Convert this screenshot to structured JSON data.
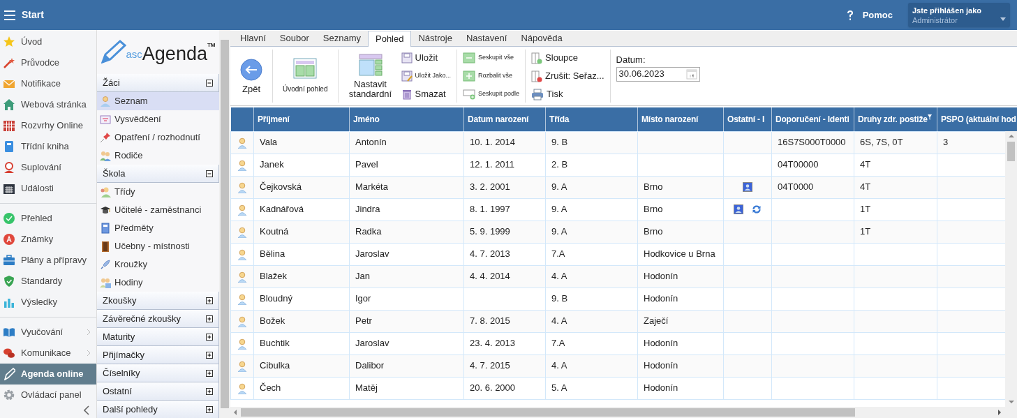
{
  "header": {
    "title": "Start",
    "help": "Pomoc",
    "user": {
      "caption": "Jste přihlášen jako",
      "name": "Administrátor"
    }
  },
  "nav": {
    "sections": [
      {
        "items": [
          {
            "label": "Úvod",
            "selected": false
          },
          {
            "label": "Průvodce",
            "selected": false
          },
          {
            "label": "Notifikace",
            "selected": false
          },
          {
            "label": "Webová stránka",
            "selected": false
          },
          {
            "label": "Rozvrhy Online",
            "selected": false
          },
          {
            "label": "Třídní kniha",
            "selected": false
          },
          {
            "label": "Suplování",
            "selected": false
          },
          {
            "label": "Události",
            "selected": false
          }
        ]
      },
      {
        "items": [
          {
            "label": "Přehled",
            "selected": false
          },
          {
            "label": "Známky",
            "selected": false
          },
          {
            "label": "Plány a přípravy",
            "selected": false
          },
          {
            "label": "Standardy",
            "selected": false
          },
          {
            "label": "Výsledky",
            "selected": false
          }
        ]
      },
      {
        "items": [
          {
            "label": "Vyučování",
            "selected": false,
            "submenu": true
          },
          {
            "label": "Komunikace",
            "selected": false,
            "submenu": true
          },
          {
            "label": "Agenda online",
            "selected": true
          },
          {
            "label": "Ovládací panel",
            "selected": false
          }
        ]
      }
    ]
  },
  "logo": {
    "prefix": "asc",
    "name": "Agenda",
    "mark": "TM"
  },
  "accordion": [
    {
      "title": "Žáci",
      "expanded": true,
      "items": [
        {
          "label": "Seznam",
          "selected": true
        },
        {
          "label": "Vysvědčení",
          "selected": false
        },
        {
          "label": "Opatření / rozhodnutí",
          "selected": false
        },
        {
          "label": "Rodiče",
          "selected": false
        }
      ]
    },
    {
      "title": "Škola",
      "expanded": true,
      "items": [
        {
          "label": "Třídy",
          "selected": false
        },
        {
          "label": "Učitelé - zaměstnanci",
          "selected": false
        },
        {
          "label": "Předměty",
          "selected": false
        },
        {
          "label": "Učebny - místnosti",
          "selected": false
        },
        {
          "label": "Kroužky",
          "selected": false
        },
        {
          "label": "Hodiny",
          "selected": false
        }
      ]
    },
    {
      "title": "Zkoušky",
      "expanded": false
    },
    {
      "title": "Závěrečné zkoušky",
      "expanded": false
    },
    {
      "title": "Maturity",
      "expanded": false
    },
    {
      "title": "Přijímačky",
      "expanded": false
    },
    {
      "title": "Číselníky",
      "expanded": false
    },
    {
      "title": "Ostatní",
      "expanded": false
    },
    {
      "title": "Další pohledy",
      "expanded": false
    }
  ],
  "tabs": [
    {
      "label": "Hlavní",
      "selected": false
    },
    {
      "label": "Soubor",
      "selected": false
    },
    {
      "label": "Seznamy",
      "selected": false
    },
    {
      "label": "Pohled",
      "selected": true
    },
    {
      "label": "Nástroje",
      "selected": false
    },
    {
      "label": "Nastavení",
      "selected": false
    },
    {
      "label": "Nápověda",
      "selected": false
    }
  ],
  "ribbon": [
    {
      "buttons": [
        {
          "label": "Zpět",
          "kind": "large"
        }
      ]
    },
    {
      "buttons": [
        {
          "label": "Úvodní pohled",
          "kind": "tile"
        }
      ]
    },
    {
      "buttons": [
        {
          "label": "Nastavit standardní",
          "kind": "large"
        },
        {
          "label": "Uložit",
          "kind": "row"
        },
        {
          "label": "Uložit Jako...",
          "kind": "row-small"
        },
        {
          "label": "Smazat",
          "kind": "row"
        }
      ]
    },
    {
      "buttons": [
        {
          "label": "Seskupit vše",
          "kind": "row-small"
        },
        {
          "label": "Rozbalit vše",
          "kind": "row-small"
        },
        {
          "label": "Seskupit podle",
          "kind": "row-small"
        }
      ]
    },
    {
      "buttons": [
        {
          "label": "Sloupce",
          "kind": "row"
        },
        {
          "label": "Zrušit: Seřaz...",
          "kind": "row"
        },
        {
          "label": "Tisk",
          "kind": "row"
        }
      ]
    }
  ],
  "date_field": {
    "label": "Datum:",
    "value": "30.06.2023"
  },
  "table": {
    "columns": [
      {
        "label": "Příjmení"
      },
      {
        "label": "Jméno"
      },
      {
        "label": "Datum narození"
      },
      {
        "label": "Třída"
      },
      {
        "label": "Místo narození"
      },
      {
        "label": "Ostatní - I"
      },
      {
        "label": "Doporučení - Identi"
      },
      {
        "label": "Druhy zdr. postiže",
        "filter": true
      },
      {
        "label": "PSPO (aktuální hod"
      }
    ],
    "rows": [
      {
        "cells": [
          "Vala",
          "Antonín",
          "10. 1. 2014",
          "9. B",
          null,
          null,
          "16S7S000T0000",
          "6S, 7S, 0T",
          "3"
        ]
      },
      {
        "cells": [
          "Janek",
          "Pavel",
          "12. 1. 2011",
          "2. B",
          null,
          null,
          "04T00000",
          "4T",
          null
        ]
      },
      {
        "cells": [
          "Čejkovská",
          "Markéta",
          "3. 2. 2001",
          "9. A",
          "Brno",
          [
            {
              "kind": "card"
            }
          ],
          "04T0000",
          "4T",
          null
        ]
      },
      {
        "cells": [
          "Kadnářová",
          "Jindra",
          "8. 1. 1997",
          "9. A",
          "Brno",
          [
            {
              "kind": "card"
            },
            {
              "kind": "sync"
            }
          ],
          null,
          "1T",
          null
        ]
      },
      {
        "cells": [
          "Koutná",
          "Radka",
          "5. 9. 1999",
          "9. A",
          "Brno",
          null,
          null,
          "1T",
          null
        ]
      },
      {
        "cells": [
          "Bělina",
          "Jaroslav",
          "4. 7. 2013",
          "7.A",
          "Hodkovice u Brna",
          null,
          null,
          null,
          null
        ]
      },
      {
        "cells": [
          "Blažek",
          "Jan",
          "4. 4. 2014",
          "4. A",
          "Hodonín",
          null,
          null,
          null,
          null
        ]
      },
      {
        "cells": [
          "Bloudný",
          "Igor",
          null,
          "9. B",
          "Hodonín",
          null,
          null,
          null,
          null
        ]
      },
      {
        "cells": [
          "Božek",
          "Petr",
          "7. 8. 2015",
          "4. A",
          "Zaječí",
          null,
          null,
          null,
          null
        ]
      },
      {
        "cells": [
          "Buchtik",
          "Jaroslav",
          "23. 4. 2013",
          "7.A",
          "Hodonín",
          null,
          null,
          null,
          null
        ]
      },
      {
        "cells": [
          "Cibulka",
          "Dalibor",
          "4. 7. 2015",
          "4. A",
          "Hodonín",
          null,
          null,
          null,
          null
        ]
      },
      {
        "cells": [
          "Čech",
          "Matěj",
          "20. 6. 2000",
          "5. A",
          "Hodonín",
          null,
          null,
          null,
          null
        ]
      }
    ]
  }
}
